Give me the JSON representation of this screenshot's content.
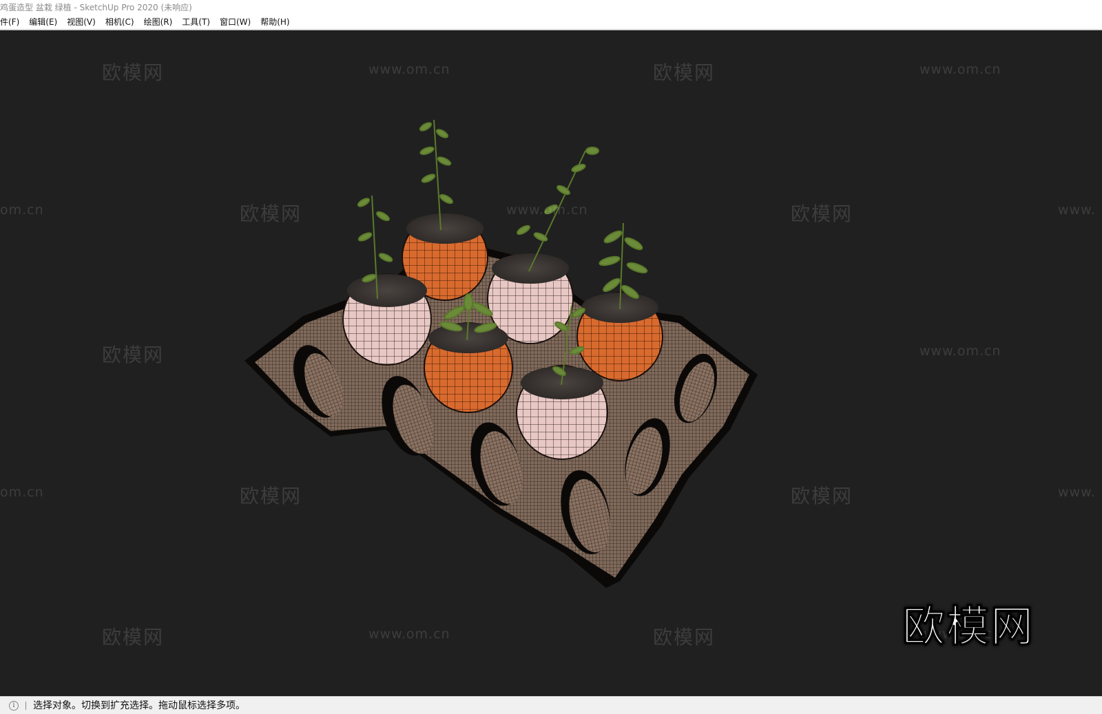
{
  "window": {
    "title": "鸡蛋造型 盆栽 绿植 - SketchUp Pro 2020 (未响应)"
  },
  "menu": {
    "items": [
      {
        "label": "件(F)"
      },
      {
        "label": "编辑(E)"
      },
      {
        "label": "视图(V)"
      },
      {
        "label": "相机(C)"
      },
      {
        "label": "绘图(R)"
      },
      {
        "label": "工具(T)"
      },
      {
        "label": "窗口(W)"
      },
      {
        "label": "帮助(H)"
      }
    ]
  },
  "watermarks": {
    "cn": "欧模网",
    "url": "www.om.cn",
    "url_cut_left": "om.cn",
    "url_cut_right": "www.",
    "big": "欧模网"
  },
  "statusbar": {
    "icon": "info-icon",
    "text": "选择对象。切换到扩充选择。拖动鼠标选择多项。"
  },
  "colors": {
    "viewport_bg": "#202020",
    "orange_pot": "#d96a2e",
    "pink_pot": "#e8c8c4",
    "soil": "#3a3532",
    "leaf": "#6b8a3a",
    "tray": "#7a6656"
  }
}
